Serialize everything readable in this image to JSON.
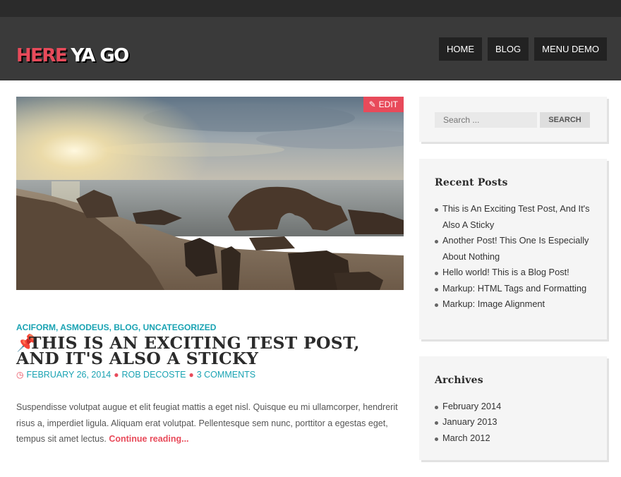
{
  "site": {
    "logo_part1": "HERE",
    "logo_part2": "YA GO"
  },
  "nav": {
    "items": [
      "HOME",
      "BLOG",
      "MENU DEMO"
    ]
  },
  "post": {
    "edit_label": "EDIT",
    "categories": [
      "ACIFORM",
      "ASMODEUS",
      "BLOG",
      "UNCATEGORIZED"
    ],
    "title": "THIS IS AN EXCITING TEST POST, AND IT'S ALSO A STICKY",
    "date": "FEBRUARY 26, 2014",
    "author": "ROB DECOSTE",
    "comments": "3 COMMENTS",
    "excerpt": "Suspendisse volutpat augue et elit feugiat mattis a eget nisl. Quisque eu mi ullamcorper, hendrerit risus a, imperdiet ligula. Aliquam erat volutpat. Pellentesque sem nunc, porttitor a egestas eget, tempus sit amet lectus.",
    "read_more": "Continue reading..."
  },
  "sidebar": {
    "search": {
      "placeholder": "Search ...",
      "button": "SEARCH"
    },
    "recent": {
      "title": "Recent Posts",
      "items": [
        "This is An Exciting Test Post, And It's Also A Sticky",
        "Another Post! This One Is Especially About Nothing",
        "Hello world! This is a Blog Post!",
        "Markup: HTML Tags and Formatting",
        "Markup: Image Alignment"
      ]
    },
    "archives": {
      "title": "Archives",
      "items": [
        "February 2014",
        "January 2013",
        "March 2012"
      ]
    }
  },
  "colors": {
    "accent": "#e84a5a",
    "link": "#1aa3b3",
    "header_bg": "#3a3a3a"
  },
  "icons": {
    "edit": "edit-icon",
    "pin": "pushpin-icon",
    "clock": "clock-icon",
    "user": "user-icon",
    "comments": "comments-icon"
  }
}
